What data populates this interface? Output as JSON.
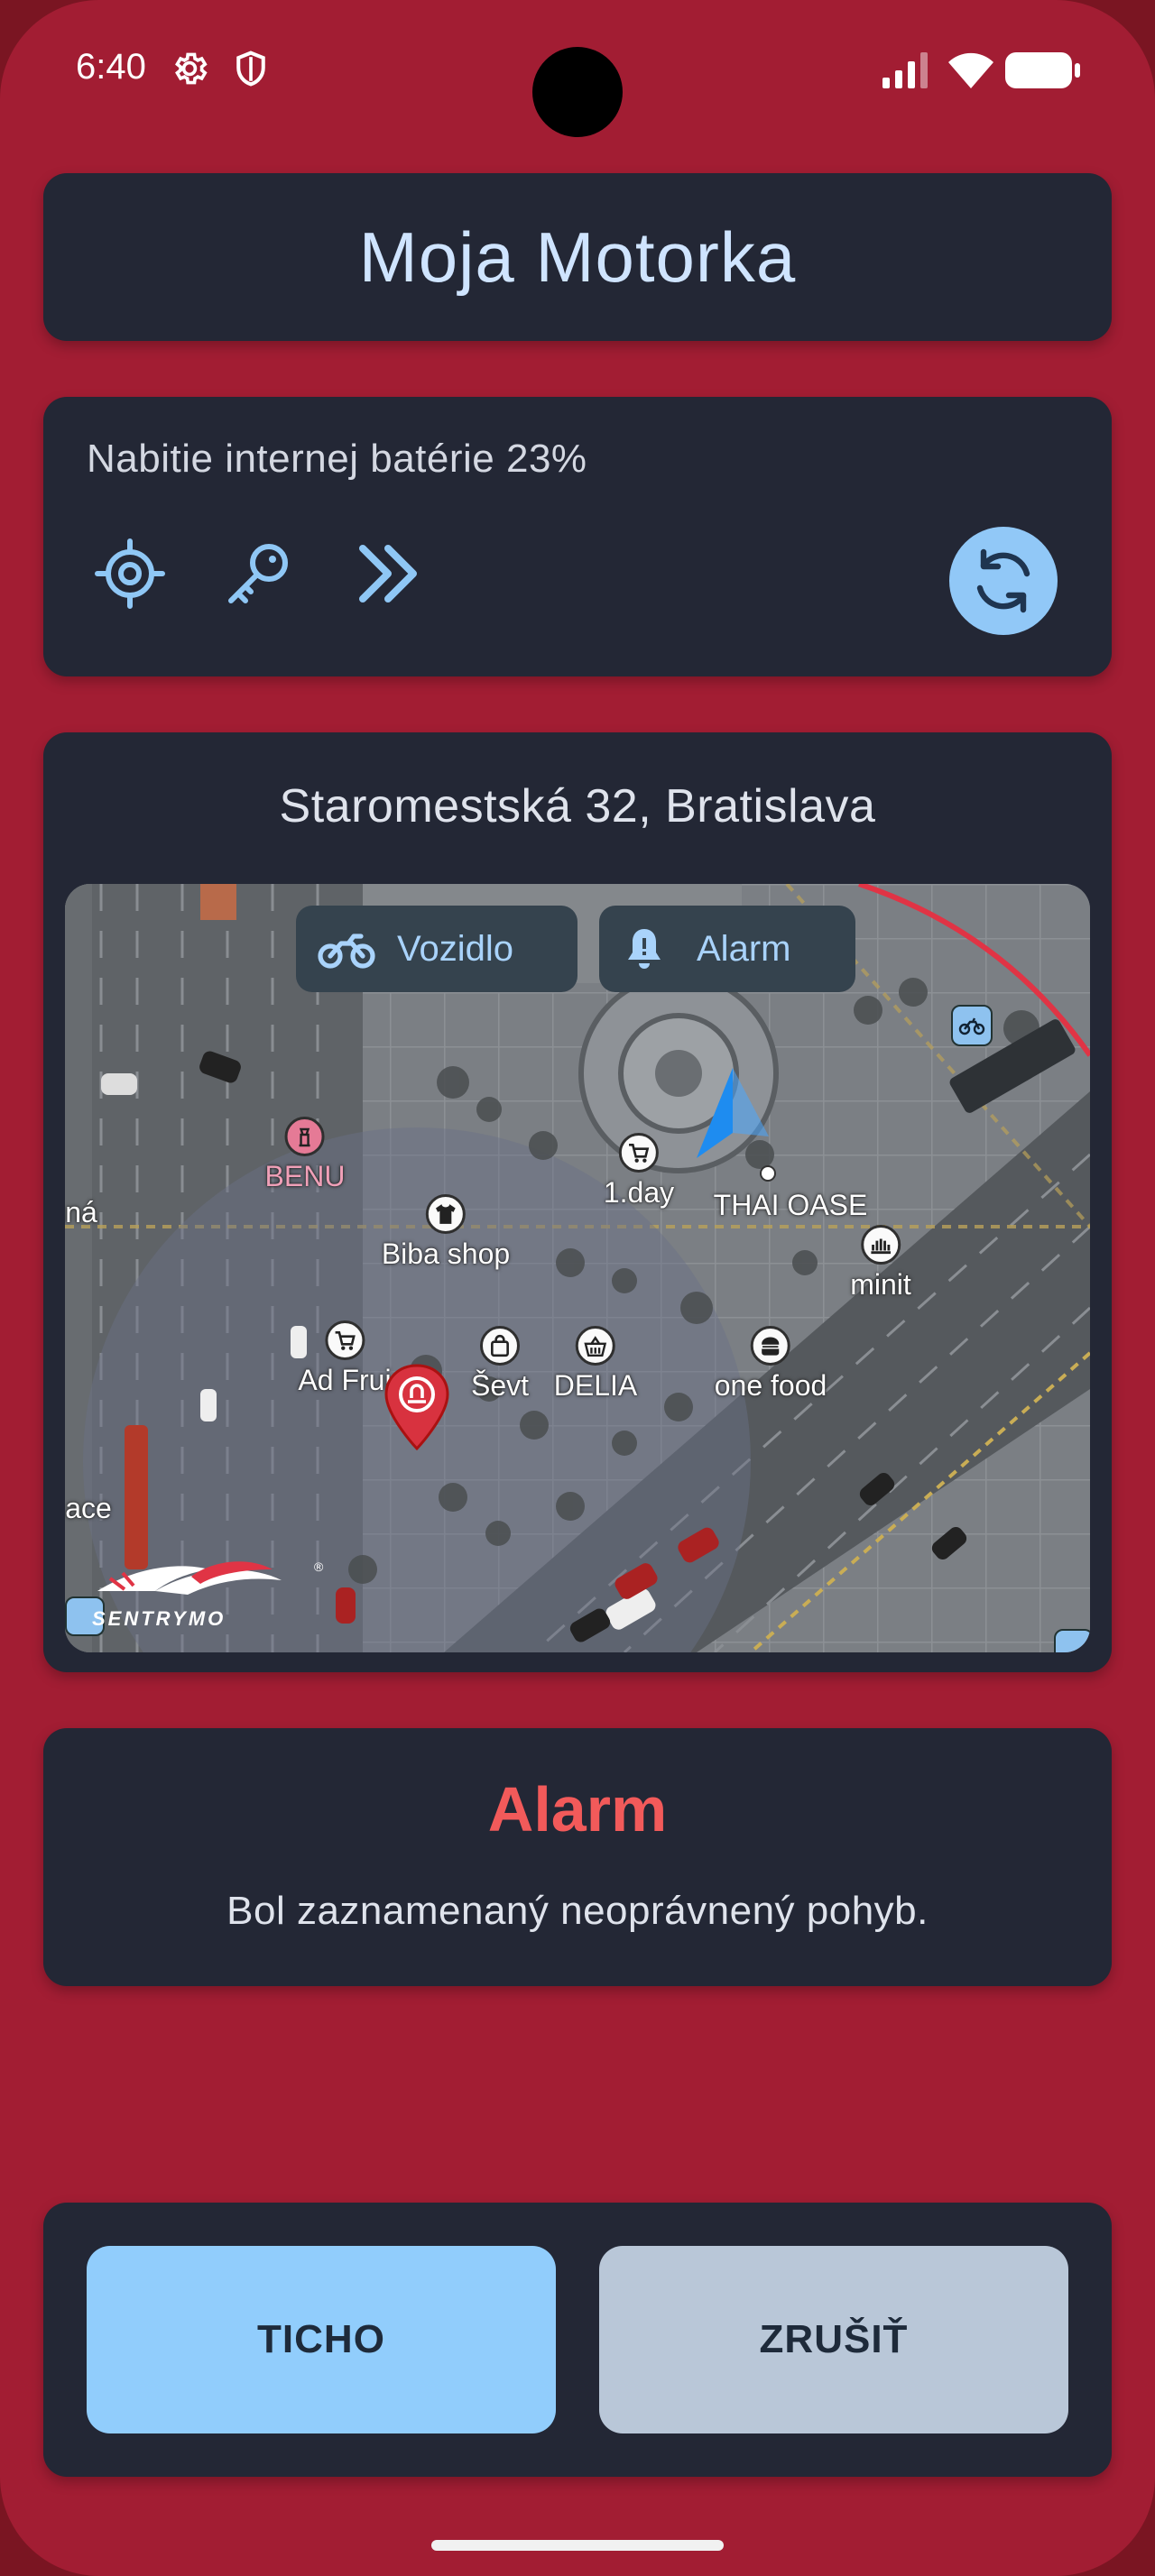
{
  "status_bar": {
    "time": "6:40"
  },
  "header": {
    "title": "Moja Motorka"
  },
  "battery": {
    "text": "Nabitie internej batérie 23%"
  },
  "location": {
    "address": "Staromestská 32, Bratislava"
  },
  "map": {
    "chips": {
      "vehicle": "Vozidlo",
      "alarm": "Alarm"
    },
    "pois": [
      {
        "label": "BENU"
      },
      {
        "label": "1.day"
      },
      {
        "label": "THAI OASE"
      },
      {
        "label": "Biba shop"
      },
      {
        "label": "minit"
      },
      {
        "label": "Ad Frui"
      },
      {
        "label": "Ševt"
      },
      {
        "label": "DELIA"
      },
      {
        "label": "one food"
      },
      {
        "label": "ná"
      },
      {
        "label": "ace"
      }
    ],
    "logo_text": "SENTRYMO"
  },
  "alarm": {
    "title": "Alarm",
    "message": "Bol zaznamenaný neoprávnený pohyb."
  },
  "actions": {
    "silent_label": "TICHO",
    "cancel_label": "ZRUŠIŤ"
  },
  "colors": {
    "frame": "#a21d33",
    "card": "#232735",
    "accent": "#91c8f7",
    "alarm": "#f25a5a"
  }
}
